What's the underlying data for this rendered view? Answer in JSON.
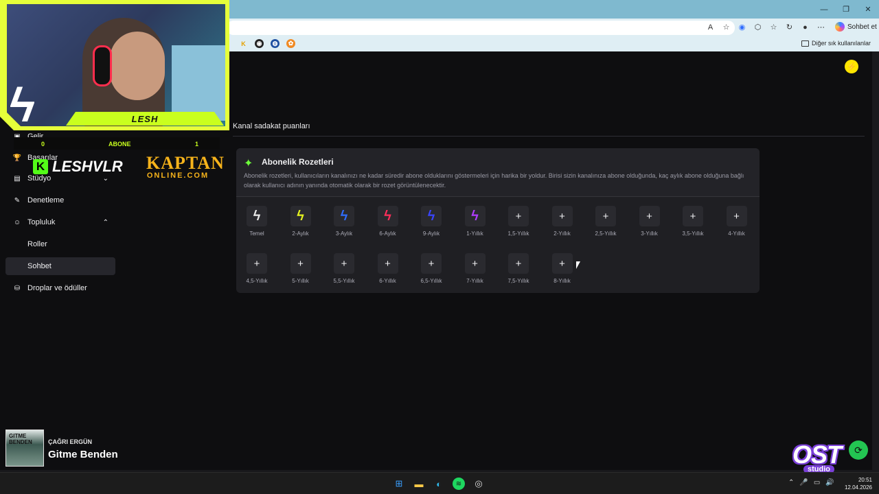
{
  "browser": {
    "copilot_label": "Sohbet et",
    "bookmarks_other": "Diğer sık kullanılanlar",
    "addr_icons": [
      "read-aloud-icon",
      "star-icon",
      "voice-icon",
      "extensions-icon",
      "favorites-icon",
      "history-icon",
      "profile-icon",
      "more-icon"
    ],
    "bookmark_letter": "K"
  },
  "page": {
    "section_title": "Kanal sadakat puanları"
  },
  "sidebar": {
    "items": [
      {
        "label": "Gelir",
        "icon": "revenue-icon"
      },
      {
        "label": "Başarılar",
        "icon": "trophy-icon"
      },
      {
        "label": "Stüdyo",
        "icon": "studio-icon"
      },
      {
        "label": "Denetleme",
        "icon": "wrench-icon"
      },
      {
        "label": "Topluluk",
        "icon": "community-icon"
      },
      {
        "label": "Roller",
        "icon": ""
      },
      {
        "label": "Sohbet",
        "icon": ""
      },
      {
        "label": "Droplar ve ödüller",
        "icon": "drops-icon"
      }
    ]
  },
  "card": {
    "title": "Abonelik Rozetleri",
    "description": "Abonelik rozetleri, kullanıcıların kanalınızı ne kadar süredir abone olduklarını göstermeleri için harika bir yoldur. Birisi sizin kanalınıza abone olduğunda, kaç aylık abone olduğuna bağlı olarak kullanıcı adının yanında otomatik olarak bir rozet görüntülenecektir.",
    "badges": [
      {
        "label": "Temel",
        "kind": "bolt",
        "color": "#e8e8e8"
      },
      {
        "label": "2-Aylık",
        "kind": "bolt",
        "color": "#e4f21f"
      },
      {
        "label": "3-Aylık",
        "kind": "bolt",
        "color": "#2f6dff"
      },
      {
        "label": "6-Aylık",
        "kind": "bolt",
        "color": "#ff2e5a"
      },
      {
        "label": "9-Aylık",
        "kind": "bolt",
        "color": "#3a45ff"
      },
      {
        "label": "1-Yıllık",
        "kind": "bolt",
        "color": "#b13cff"
      },
      {
        "label": "1,5-Yıllık",
        "kind": "plus"
      },
      {
        "label": "2-Yıllık",
        "kind": "plus"
      },
      {
        "label": "2,5-Yıllık",
        "kind": "plus"
      },
      {
        "label": "3-Yıllık",
        "kind": "plus"
      },
      {
        "label": "3,5-Yıllık",
        "kind": "plus"
      },
      {
        "label": "4-Yıllık",
        "kind": "plus"
      },
      {
        "label": "4,5-Yıllık",
        "kind": "plus"
      },
      {
        "label": "5-Yıllık",
        "kind": "plus"
      },
      {
        "label": "5,5-Yıllık",
        "kind": "plus"
      },
      {
        "label": "6-Yıllık",
        "kind": "plus"
      },
      {
        "label": "6,5-Yıllık",
        "kind": "plus"
      },
      {
        "label": "7-Yıllık",
        "kind": "plus"
      },
      {
        "label": "7,5-Yıllık",
        "kind": "plus"
      },
      {
        "label": "8-Yıllık",
        "kind": "plus"
      }
    ]
  },
  "overlay": {
    "streamer_name": "LESH",
    "sub_goal_current": "0",
    "sub_goal_label": "ABONE",
    "sub_goal_target": "1",
    "sub_goal_progress": 0,
    "kick_name": "LESHVLR",
    "sponsor_top": "KAPTAN",
    "sponsor_bottom": "ONLINE.COM"
  },
  "music": {
    "cover_text": "GITME BENDEN",
    "artist": "ÇAĞRI ERGÜN",
    "title": "Gitme Benden"
  },
  "branding": {
    "ost_text": "OST",
    "ost_studio": "studio"
  },
  "taskbar": {
    "apps": [
      "windows-start-icon",
      "file-explorer-icon",
      "edge-icon",
      "spotify-icon",
      "obs-icon"
    ],
    "time": "20:51",
    "date": "12.04.2026"
  },
  "colors": {
    "kick_green": "#53fc18",
    "accent_yellow": "#ffe500",
    "sparkle_green": "#6dff3a"
  }
}
